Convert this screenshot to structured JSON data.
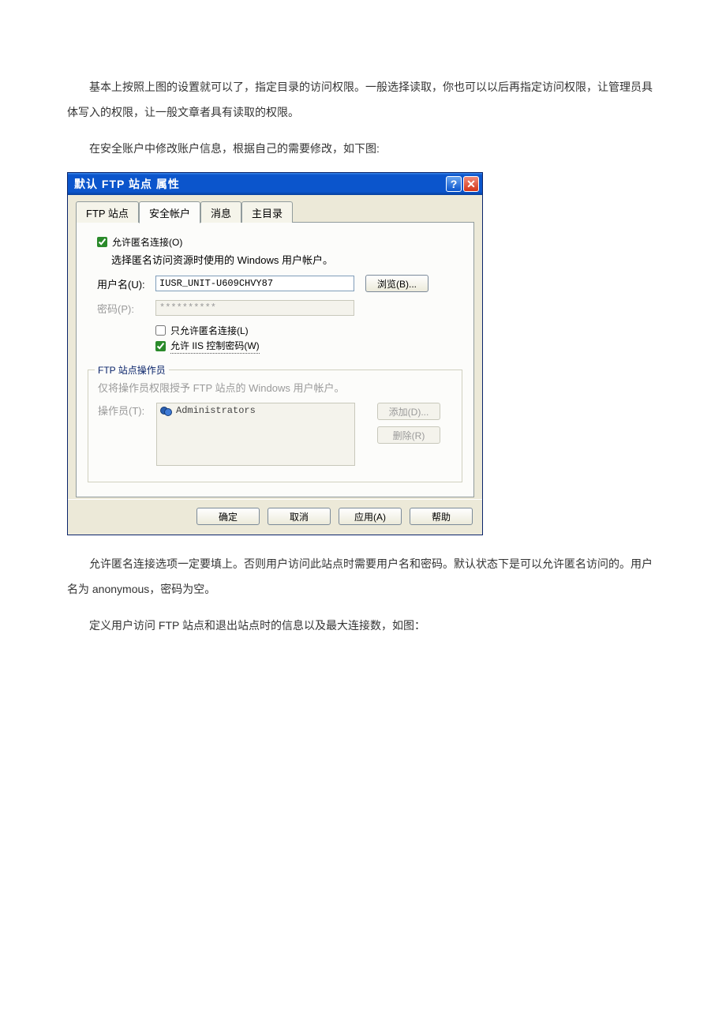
{
  "doc": {
    "para1": "基本上按照上图的设置就可以了，指定目录的访问权限。一般选择读取，你也可以以后再指定访问权限，让管理员具体写入的权限，让一般文章者具有读取的权限。",
    "para2": "在安全账户中修改账户信息，根据自己的需要修改，如下图:",
    "para3a": "允许匿名连接选项一定要填上。否则用户访问此站点时需要用户名和密码。默认状态下是可以允许匿名访问的。用户名为 ",
    "para3b": "anonymous",
    "para3c": "，密码为空。",
    "para4a": "定义用户访问 ",
    "para4b": "FTP",
    "para4c": " 站点和退出站点时的信息以及最大连接数，如图："
  },
  "dialog": {
    "title": "默认 FTP 站点 属性",
    "help_glyph": "?",
    "close_glyph": "✕",
    "tabs": [
      "FTP 站点",
      "安全帐户",
      "消息",
      "主目录"
    ],
    "active_tab_index": 1,
    "anonymous": {
      "checkbox_label": "允许匿名连接(O)",
      "hint": "选择匿名访问资源时使用的 Windows 用户帐户。",
      "username_label": "用户名(U):",
      "username_value": "IUSR_UNIT-U609CHVY87",
      "browse_btn": "浏览(B)...",
      "password_label": "密码(P):",
      "password_value": "**********",
      "only_anon_label": "只允许匿名连接(L)",
      "iis_pwd_label": "允许 IIS 控制密码(W)"
    },
    "operators": {
      "group_title": "FTP 站点操作员",
      "hint": "仅将操作员权限授予 FTP 站点的 Windows 用户帐户。",
      "label": "操作员(T):",
      "list_item": "Administrators",
      "add_btn": "添加(D)...",
      "remove_btn": "删除(R)"
    },
    "buttons": {
      "ok": "确定",
      "cancel": "取消",
      "apply": "应用(A)",
      "help": "帮助"
    }
  }
}
